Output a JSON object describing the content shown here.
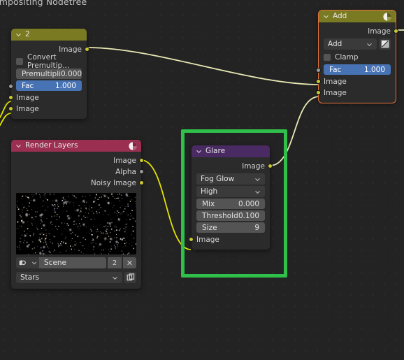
{
  "editor": {
    "title": "ompositing Nodetree",
    "background_color": "#232323",
    "grid_color": "#2b2b2b"
  },
  "colors": {
    "noodle": "#e9e9b4",
    "noodle_bright": "#e3e300",
    "socket_image": "#ccc92f",
    "socket_value": "#9b9b9b",
    "annotation_green": "#2fbf4a",
    "selection_orange": "#e8743b",
    "header_converter": "#7a7a22",
    "header_input": "#9b2f52",
    "header_filter": "#4a2a62",
    "slider_blue": "#4772b3"
  },
  "nodes": [
    {
      "id": "alphaover",
      "title": "2",
      "header_color": "#7a7a22",
      "selected": false,
      "outputs": [
        {
          "name": "Image",
          "type": "image"
        }
      ],
      "widgets": [
        {
          "kind": "checkbox",
          "label": "Convert Premultip...",
          "checked": false
        },
        {
          "kind": "field",
          "label": "Premultipli",
          "value": "0.000",
          "highlighted": false
        },
        {
          "kind": "field",
          "label": "Fac",
          "value": "1.000",
          "highlighted": true
        }
      ],
      "inputs": [
        {
          "name": "Image",
          "type": "image"
        },
        {
          "name": "Image",
          "type": "image"
        }
      ],
      "fac_socket": {
        "name": "Fac",
        "type": "value"
      }
    },
    {
      "id": "add",
      "title": "Add",
      "header_color": "#7a7a22",
      "header_icon": "mix-color-icon",
      "selected": true,
      "outputs": [
        {
          "name": "Image",
          "type": "image"
        }
      ],
      "widgets": [
        {
          "kind": "dropdown",
          "value": "Add",
          "trailing_icon": "curve-ramp-icon"
        },
        {
          "kind": "checkbox",
          "label": "Clamp",
          "checked": false
        },
        {
          "kind": "field",
          "label": "Fac",
          "value": "1.000",
          "highlighted": true
        }
      ],
      "inputs": [
        {
          "name": "Image",
          "type": "image"
        },
        {
          "name": "Image",
          "type": "image"
        }
      ],
      "fac_socket": {
        "name": "Fac",
        "type": "value"
      }
    },
    {
      "id": "renderlayers",
      "title": "Render Layers",
      "header_color": "#9b2f52",
      "header_icon": "scene-render-icon",
      "selected": false,
      "outputs": [
        {
          "name": "Image",
          "type": "image"
        },
        {
          "name": "Alpha",
          "type": "value"
        },
        {
          "name": "Noisy Image",
          "type": "image"
        }
      ],
      "preview": {
        "alt": "starfield-render-preview"
      },
      "scene_picker": {
        "icon": "scene-icon",
        "scene_name": "Scene",
        "users_count": "2",
        "unlink_label": "✕"
      },
      "layer_picker": {
        "value": "Stars",
        "trailing_icon": "new-layer-icon"
      }
    },
    {
      "id": "glare",
      "title": "Glare",
      "header_color": "#4a2a62",
      "selected": false,
      "annotated": true,
      "outputs": [
        {
          "name": "Image",
          "type": "image"
        }
      ],
      "widgets": [
        {
          "kind": "dropdown",
          "value": "Fog Glow"
        },
        {
          "kind": "dropdown",
          "value": "High"
        },
        {
          "kind": "field",
          "label": "Mix",
          "value": "0.000"
        },
        {
          "kind": "field",
          "label": "Threshold",
          "value": "0.100"
        },
        {
          "kind": "field",
          "label": "Size",
          "value": "9"
        }
      ],
      "inputs": [
        {
          "name": "Image",
          "type": "image"
        }
      ]
    }
  ],
  "links": [
    {
      "from": "alphaover.Image",
      "to": "add.Image1"
    },
    {
      "from": "glare.Image",
      "to": "add.Image2"
    },
    {
      "from": "renderlayers.Image",
      "to": "glare.Image"
    },
    {
      "from": "offscreen.a",
      "to": "alphaover.Image1"
    },
    {
      "from": "offscreen.b",
      "to": "alphaover.Image2"
    },
    {
      "from": "add.Image",
      "to": "offscreen.out"
    }
  ]
}
